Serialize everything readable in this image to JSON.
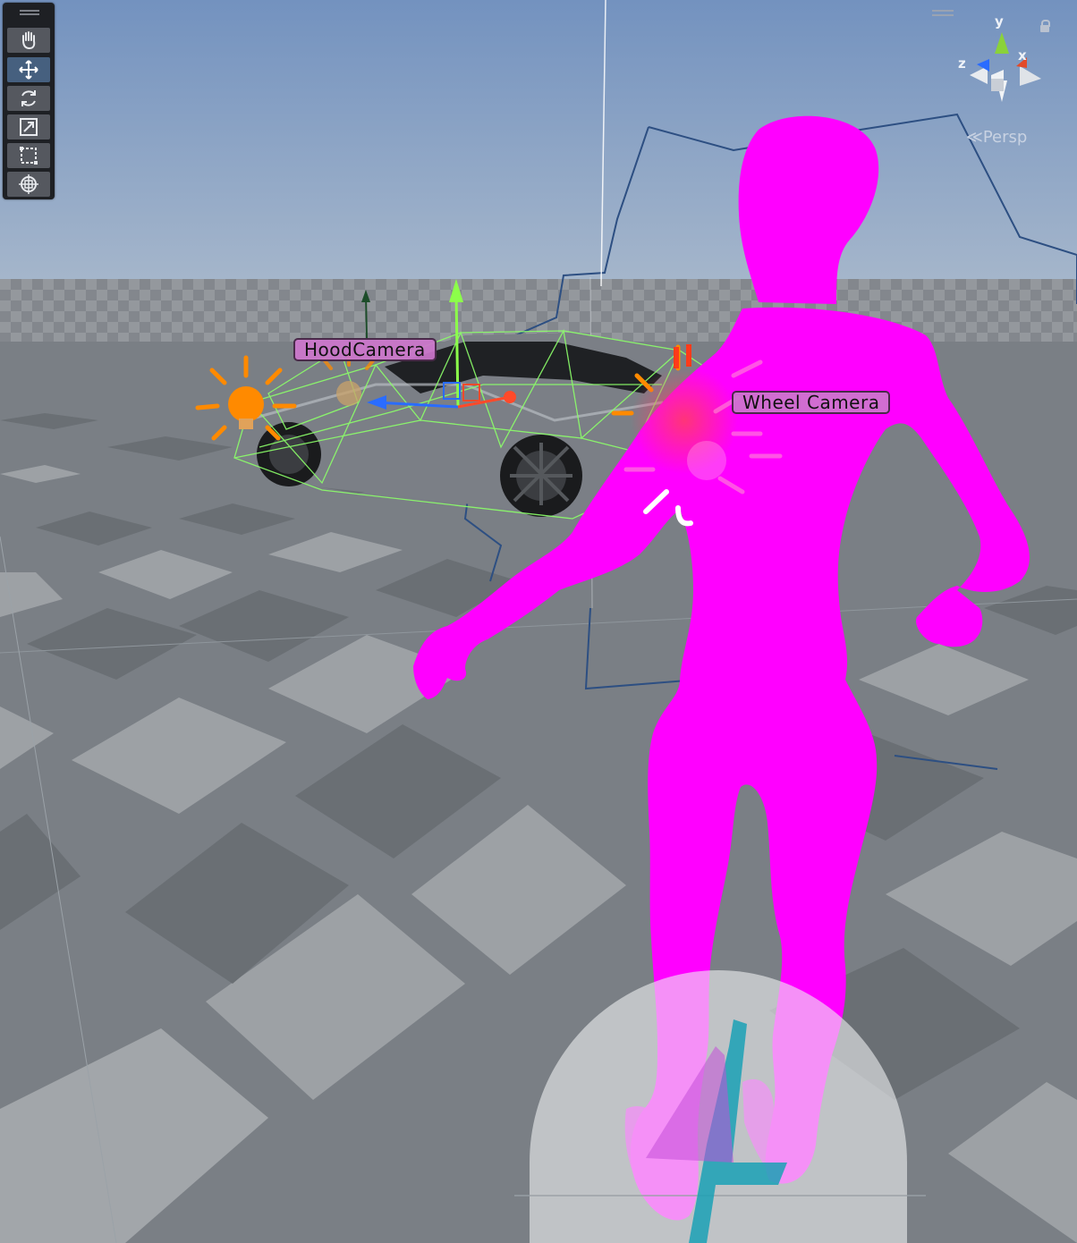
{
  "toolbar": {
    "tools": [
      {
        "name": "hand-tool",
        "icon": "hand-icon",
        "active": false
      },
      {
        "name": "move-tool",
        "icon": "move-arrows-icon",
        "active": true
      },
      {
        "name": "rotate-tool",
        "icon": "rotate-icon",
        "active": false
      },
      {
        "name": "scale-tool",
        "icon": "scale-icon",
        "active": false
      },
      {
        "name": "rect-tool",
        "icon": "rect-icon",
        "active": false
      },
      {
        "name": "transform-tool",
        "icon": "transform-icon",
        "active": false
      }
    ]
  },
  "scene": {
    "labels": {
      "hood_camera": "HoodCamera",
      "wheel_camera": "Wheel Camera"
    }
  },
  "gizmo": {
    "projection": "Persp",
    "axes": {
      "x": "x",
      "y": "y",
      "z": "z"
    }
  },
  "colors": {
    "sky": "#7a96bd",
    "ground": "#6f747a",
    "character": "#ff00ff",
    "label_bg": "#cd76cd",
    "light_icon": "#ff8a00",
    "wireframe": "#8cff6a"
  }
}
